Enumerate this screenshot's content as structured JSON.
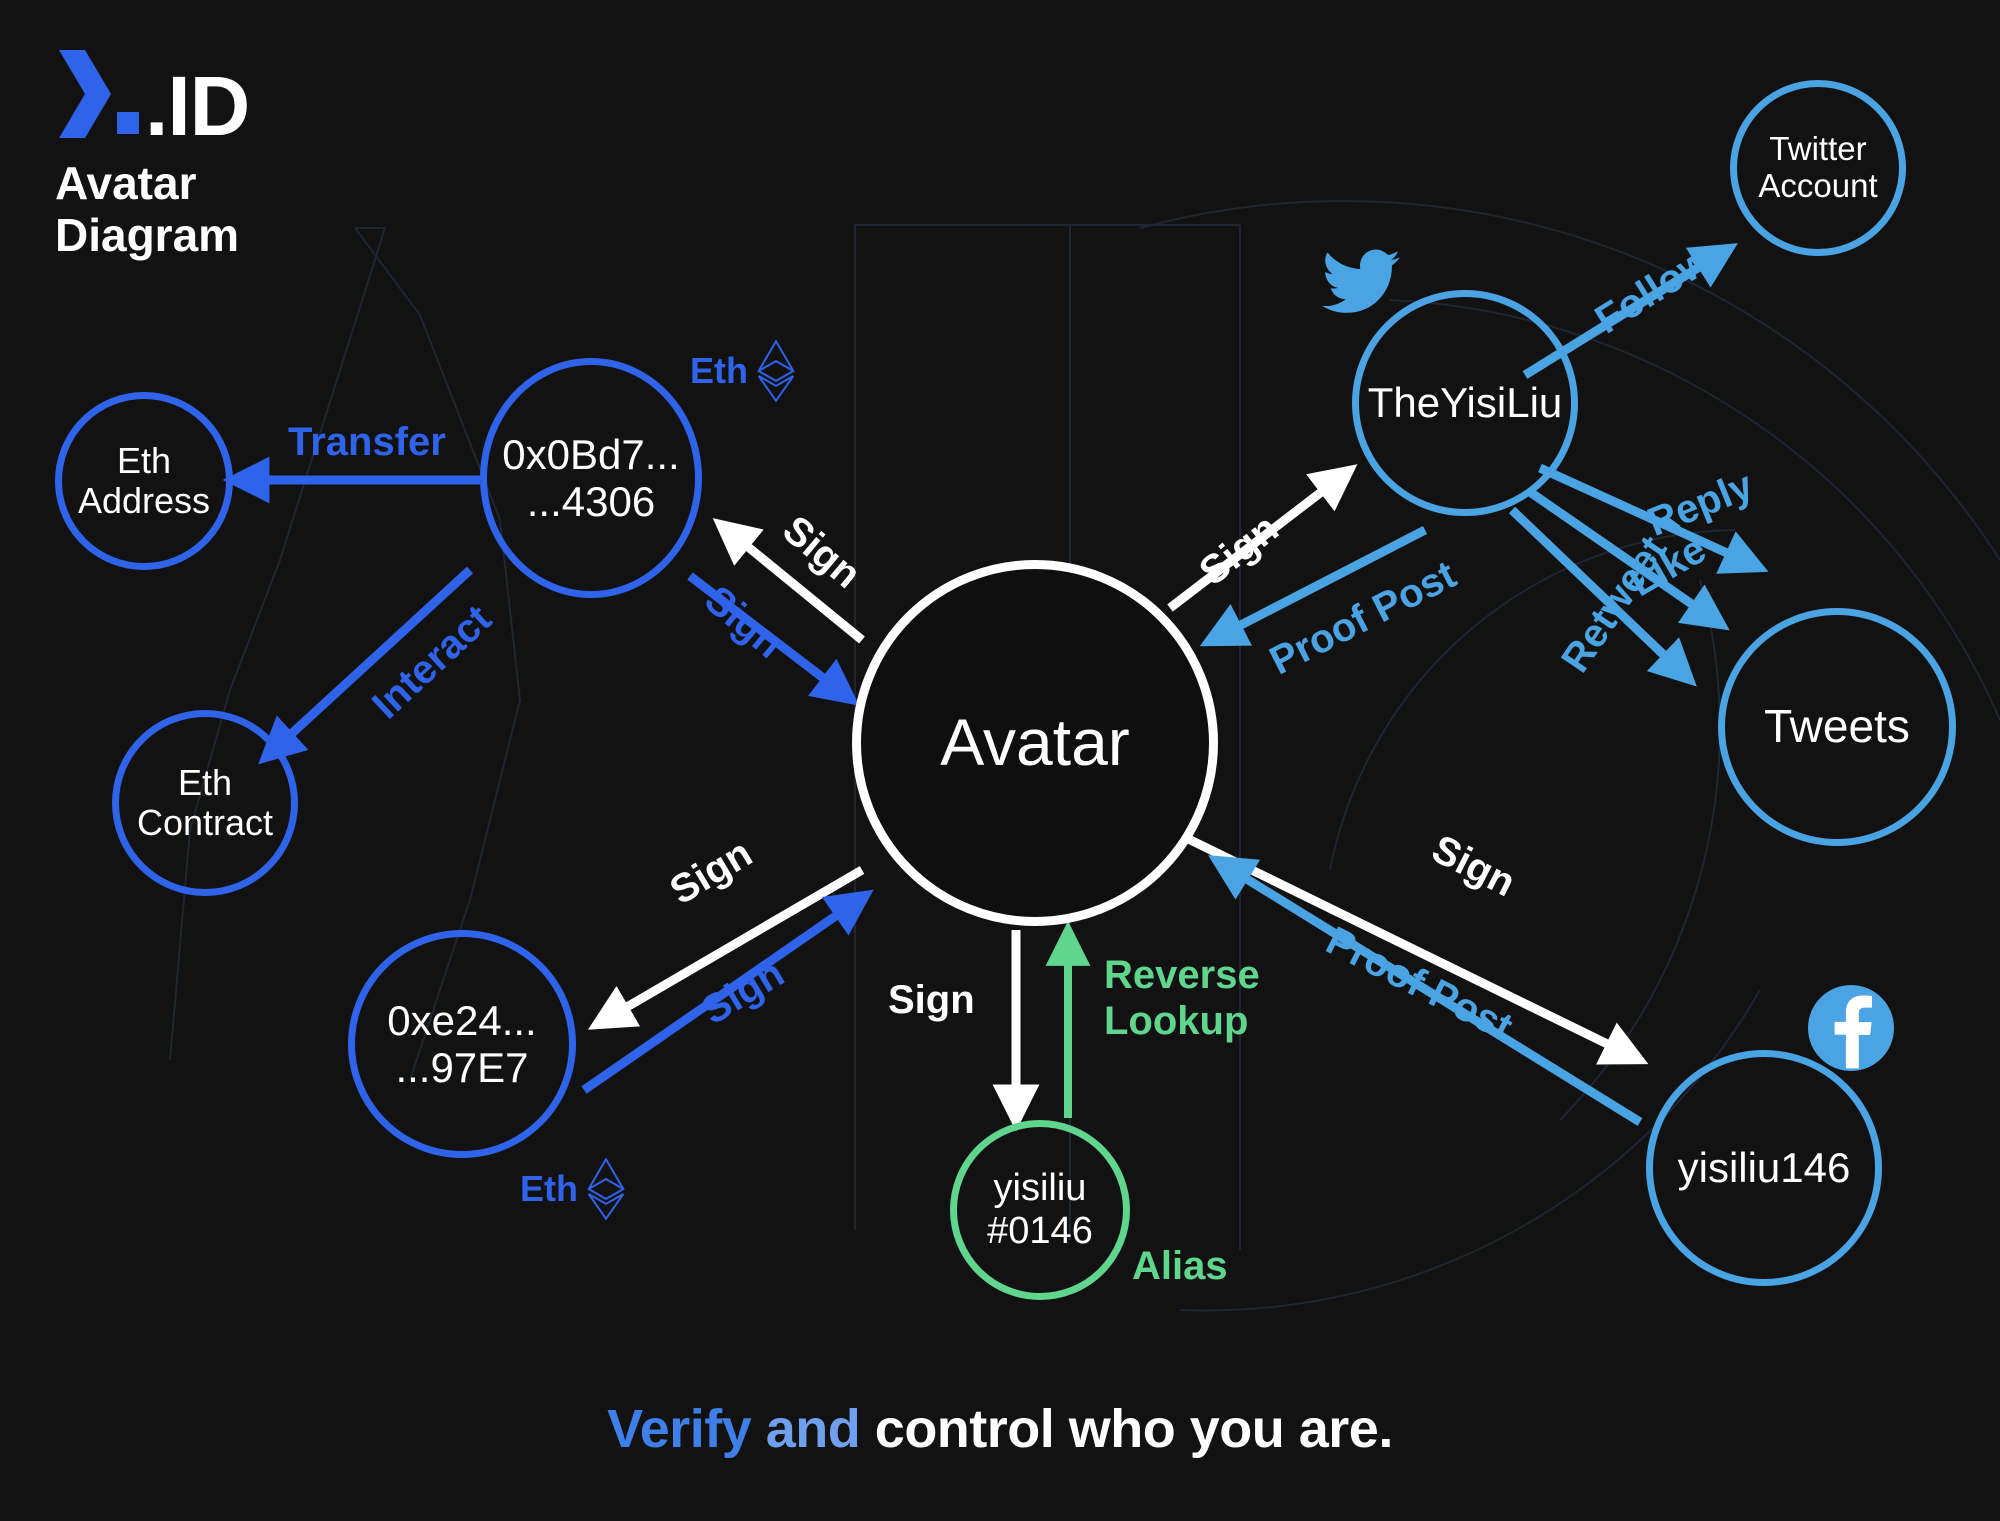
{
  "brand": {
    "logo_icon": "chevron-dot-logo",
    "logo_text": ".ID",
    "title_line1": "Avatar",
    "title_line2": "Diagram"
  },
  "tagline": {
    "part1": "Verify",
    "part2": " and ",
    "part3": "control who you are."
  },
  "colors": {
    "background": "#121212",
    "eth_blue": "#2f63ea",
    "twitter_blue": "#4aa3e2",
    "alias_green": "#5fd58d",
    "avatar_white": "#ffffff"
  },
  "chart_data": {
    "type": "diagram",
    "title": "Avatar Diagram",
    "nodes": [
      {
        "id": "eth-address",
        "label_lines": [
          "Eth",
          "Address"
        ],
        "color": "#2f63ea",
        "group": "ethereum"
      },
      {
        "id": "addr-0x0bd7",
        "label_lines": [
          "0x0Bd7...",
          "...4306"
        ],
        "color": "#2f63ea",
        "group": "ethereum",
        "badge": "Eth"
      },
      {
        "id": "eth-contract",
        "label_lines": [
          "Eth",
          "Contract"
        ],
        "color": "#2f63ea",
        "group": "ethereum"
      },
      {
        "id": "addr-0xe24",
        "label_lines": [
          "0xe24...",
          "...97E7"
        ],
        "color": "#2f63ea",
        "group": "ethereum",
        "badge": "Eth"
      },
      {
        "id": "avatar",
        "label_lines": [
          "Avatar"
        ],
        "color": "#ffffff",
        "group": "core"
      },
      {
        "id": "alias",
        "label_lines": [
          "yisiliu",
          "#0146"
        ],
        "color": "#5fd58d",
        "group": "alias",
        "badge": "Alias"
      },
      {
        "id": "theyisiliu",
        "label_lines": [
          "TheYisiLiu"
        ],
        "color": "#4aa3e2",
        "group": "twitter",
        "icon": "twitter-bird-icon"
      },
      {
        "id": "twitter-account",
        "label_lines": [
          "Twitter",
          "Account"
        ],
        "color": "#4aa3e2",
        "group": "twitter"
      },
      {
        "id": "tweets",
        "label_lines": [
          "Tweets"
        ],
        "color": "#4aa3e2",
        "group": "twitter"
      },
      {
        "id": "yisiliu146",
        "label_lines": [
          "yisiliu146"
        ],
        "color": "#4aa3e2",
        "group": "facebook",
        "icon": "facebook-icon"
      }
    ],
    "edges": [
      {
        "from": "addr-0x0bd7",
        "to": "eth-address",
        "label": "Transfer",
        "color": "#2f63ea"
      },
      {
        "from": "addr-0x0bd7",
        "to": "eth-contract",
        "label": "Interact",
        "color": "#2f63ea"
      },
      {
        "from": "avatar",
        "to": "addr-0x0bd7",
        "label": "Sign",
        "color": "#ffffff"
      },
      {
        "from": "addr-0x0bd7",
        "to": "avatar",
        "label": "Sign",
        "color": "#2f63ea"
      },
      {
        "from": "avatar",
        "to": "addr-0xe24",
        "label": "Sign",
        "color": "#ffffff"
      },
      {
        "from": "addr-0xe24",
        "to": "avatar",
        "label": "Sign",
        "color": "#2f63ea"
      },
      {
        "from": "avatar",
        "to": "alias",
        "label": "Sign",
        "color": "#ffffff"
      },
      {
        "from": "alias",
        "to": "avatar",
        "label": "Reverse Lookup",
        "color": "#5fd58d"
      },
      {
        "from": "avatar",
        "to": "theyisiliu",
        "label": "Sign",
        "color": "#ffffff"
      },
      {
        "from": "theyisiliu",
        "to": "avatar",
        "label": "Proof Post",
        "color": "#4aa3e2"
      },
      {
        "from": "theyisiliu",
        "to": "twitter-account",
        "label": "Follow",
        "color": "#4aa3e2"
      },
      {
        "from": "theyisiliu",
        "to": "tweets",
        "label": "Reply",
        "color": "#4aa3e2"
      },
      {
        "from": "theyisiliu",
        "to": "tweets",
        "label": "Like",
        "color": "#4aa3e2"
      },
      {
        "from": "theyisiliu",
        "to": "tweets",
        "label": "Retweet",
        "color": "#4aa3e2"
      },
      {
        "from": "avatar",
        "to": "yisiliu146",
        "label": "Sign",
        "color": "#ffffff"
      },
      {
        "from": "yisiliu146",
        "to": "avatar",
        "label": "Proof Post",
        "color": "#4aa3e2"
      }
    ]
  },
  "nodes": {
    "eth_address": {
      "l1": "Eth",
      "l2": "Address"
    },
    "addr_0x0bd7": {
      "l1": "0x0Bd7...",
      "l2": "...4306"
    },
    "eth_contract": {
      "l1": "Eth",
      "l2": "Contract"
    },
    "addr_0xe24": {
      "l1": "0xe24...",
      "l2": "...97E7"
    },
    "avatar": {
      "l1": "Avatar"
    },
    "alias": {
      "l1": "yisiliu",
      "l2": "#0146"
    },
    "theyisiliu": {
      "l1": "TheYisiLiu"
    },
    "twitter_account": {
      "l1": "Twitter",
      "l2": "Account"
    },
    "tweets": {
      "l1": "Tweets"
    },
    "yisiliu146": {
      "l1": "yisiliu146"
    }
  },
  "badges": {
    "eth_top": "Eth",
    "eth_bottom": "Eth",
    "alias": "Alias"
  },
  "edge_labels": {
    "transfer": "Transfer",
    "interact": "Interact",
    "sign_tl_white": "Sign",
    "sign_tl_blue": "Sign",
    "sign_bl_white": "Sign",
    "sign_bl_blue": "Sign",
    "sign_alias": "Sign",
    "reverse_lookup_1": "Reverse",
    "reverse_lookup_2": "Lookup",
    "sign_tw": "Sign",
    "proof_post_tw": "Proof Post",
    "follow": "Follow",
    "reply": "Reply",
    "like": "Like",
    "retweet": "Retweet",
    "sign_fb": "Sign",
    "proof_post_fb": "Proof Post"
  }
}
